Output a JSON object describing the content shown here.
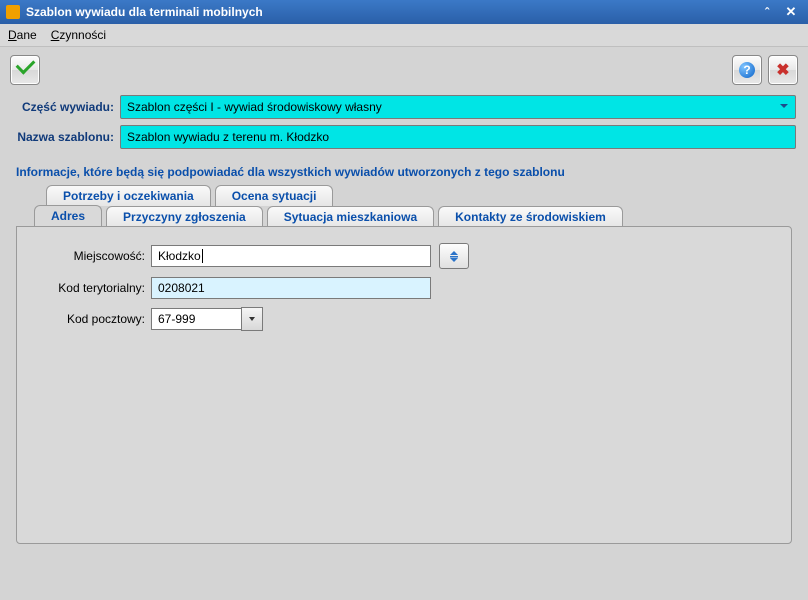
{
  "window": {
    "title": "Szablon wywiadu dla terminali mobilnych"
  },
  "menu": {
    "dane": "Dane",
    "czynnosci": "Czynności"
  },
  "icons": {
    "help_glyph": "?",
    "x_glyph": "✖",
    "min_glyph": "ˆ",
    "close_glyph": "✕"
  },
  "form": {
    "czesc_label": "Część wywiadu:",
    "czesc_value": "Szablon części I - wywiad środowiskowy własny",
    "nazwa_label": "Nazwa szablonu:",
    "nazwa_value": "Szablon wywiadu z terenu m. Kłodzko"
  },
  "section_title": "Informacje, które będą się podpowiadać dla wszystkich wywiadów utworzonych z tego szablonu",
  "tabs": {
    "row1": [
      "Potrzeby i oczekiwania",
      "Ocena sytuacji"
    ],
    "row2": [
      "Adres",
      "Przyczyny zgłoszenia",
      "Sytuacja mieszkaniowa",
      "Kontakty ze środowiskiem"
    ],
    "active": "Adres"
  },
  "adres": {
    "miejscowosc_label": "Miejscowość:",
    "miejscowosc_value": "Kłodzko",
    "kod_teryt_label": "Kod terytorialny:",
    "kod_teryt_value": "0208021",
    "kod_poczt_label": "Kod pocztowy:",
    "kod_poczt_value": "67-999"
  }
}
